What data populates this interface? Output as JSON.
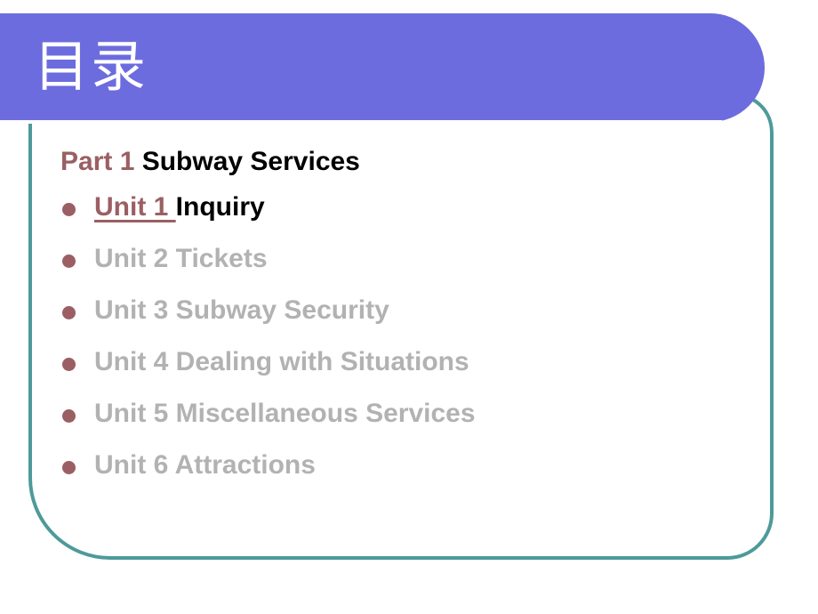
{
  "slide": {
    "title": "目录",
    "heading": {
      "part_label": "Part 1",
      "part_title": " Subway Services"
    },
    "units": [
      {
        "label": " Unit 1 ",
        "name": "Inquiry",
        "state": "active"
      },
      {
        "label": "Unit 2",
        "name": "  Tickets",
        "state": "dimmed"
      },
      {
        "label": "Unit 3",
        "name": "  Subway Security",
        "state": "dimmed"
      },
      {
        "label": "Unit 4",
        "name": "  Dealing with Situations",
        "state": "dimmed"
      },
      {
        "label": "Unit 5",
        "name": "  Miscellaneous Services",
        "state": "dimmed"
      },
      {
        "label": "Unit 6",
        "name": "  Attractions",
        "state": "dimmed"
      }
    ]
  },
  "colors": {
    "banner_purple": "#6c6cdf",
    "frame_teal": "#4e9a9a",
    "accent_maroon": "#9b5f63",
    "dimmed_grey": "#b2b2b2",
    "active_black": "#000000",
    "rule_white": "#ffffff"
  }
}
